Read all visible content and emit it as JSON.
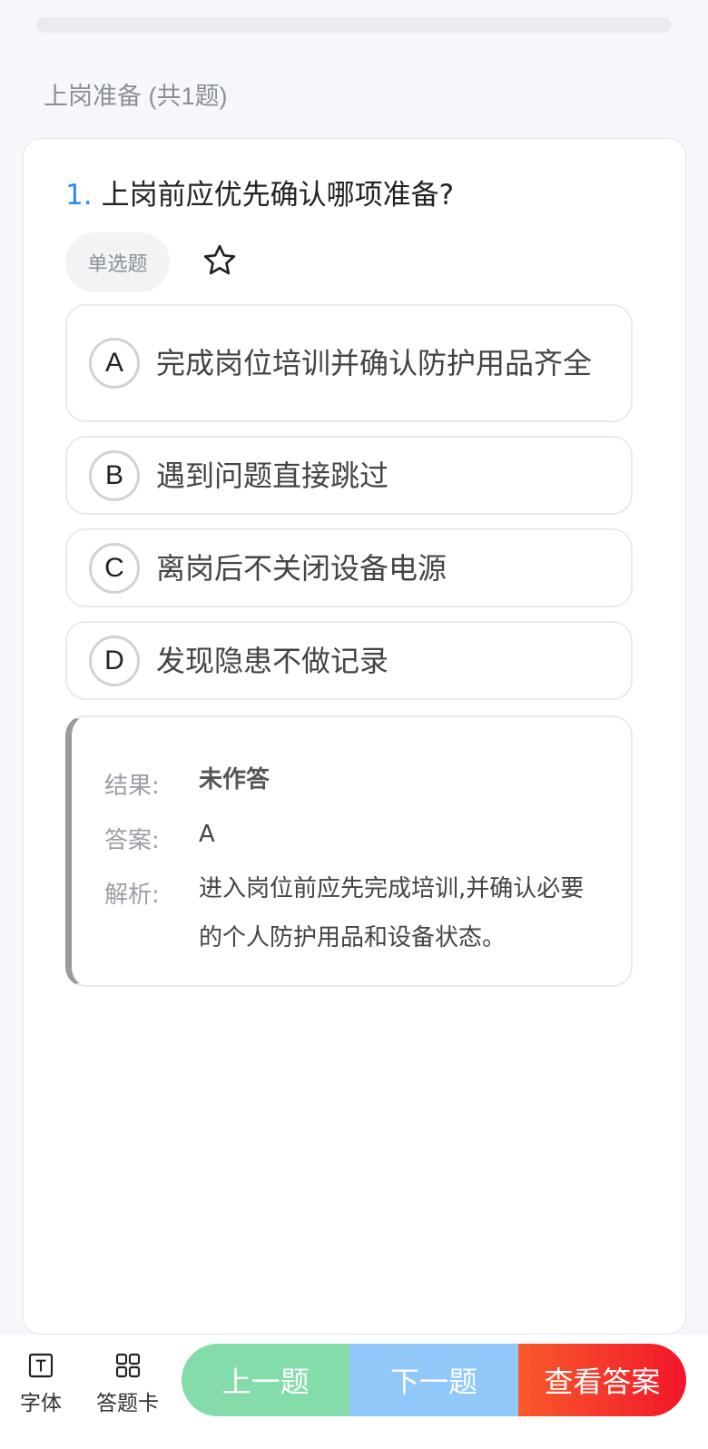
{
  "progress": {
    "fraction": 0
  },
  "section": {
    "title": "上岗准备 (共1题)"
  },
  "question": {
    "number": "1.",
    "text": "上岗前应优先确认哪项准备?",
    "type": "单选题",
    "favorite_icon": "star-outline-icon",
    "options": [
      {
        "letter": "A",
        "text": "完成岗位培训并确认防护用品齐全"
      },
      {
        "letter": "B",
        "text": "遇到问题直接跳过"
      },
      {
        "letter": "C",
        "text": "离岗后不关闭设备电源"
      },
      {
        "letter": "D",
        "text": "发现隐患不做记录"
      }
    ]
  },
  "result": {
    "result_label": "结果:",
    "result_value": "未作答",
    "answer_label": "答案:",
    "answer_value": "A",
    "analysis_label": "解析:",
    "analysis_value": "进入岗位前应先完成培训,并确认必要的个人防护用品和设备状态。"
  },
  "toolbar": {
    "font_label": "字体",
    "font_icon": "font-size-icon",
    "card_label": "答题卡",
    "card_icon": "grid-icon",
    "prev_label": "上一题",
    "next_label": "下一题",
    "answer_label": "查看答案"
  },
  "colors": {
    "accent": "#2d8cf0",
    "prev_button": "#84dcaa",
    "next_button": "#90c8fa",
    "answer_button_start": "#f85a2c",
    "answer_button_end": "#f2162a"
  }
}
